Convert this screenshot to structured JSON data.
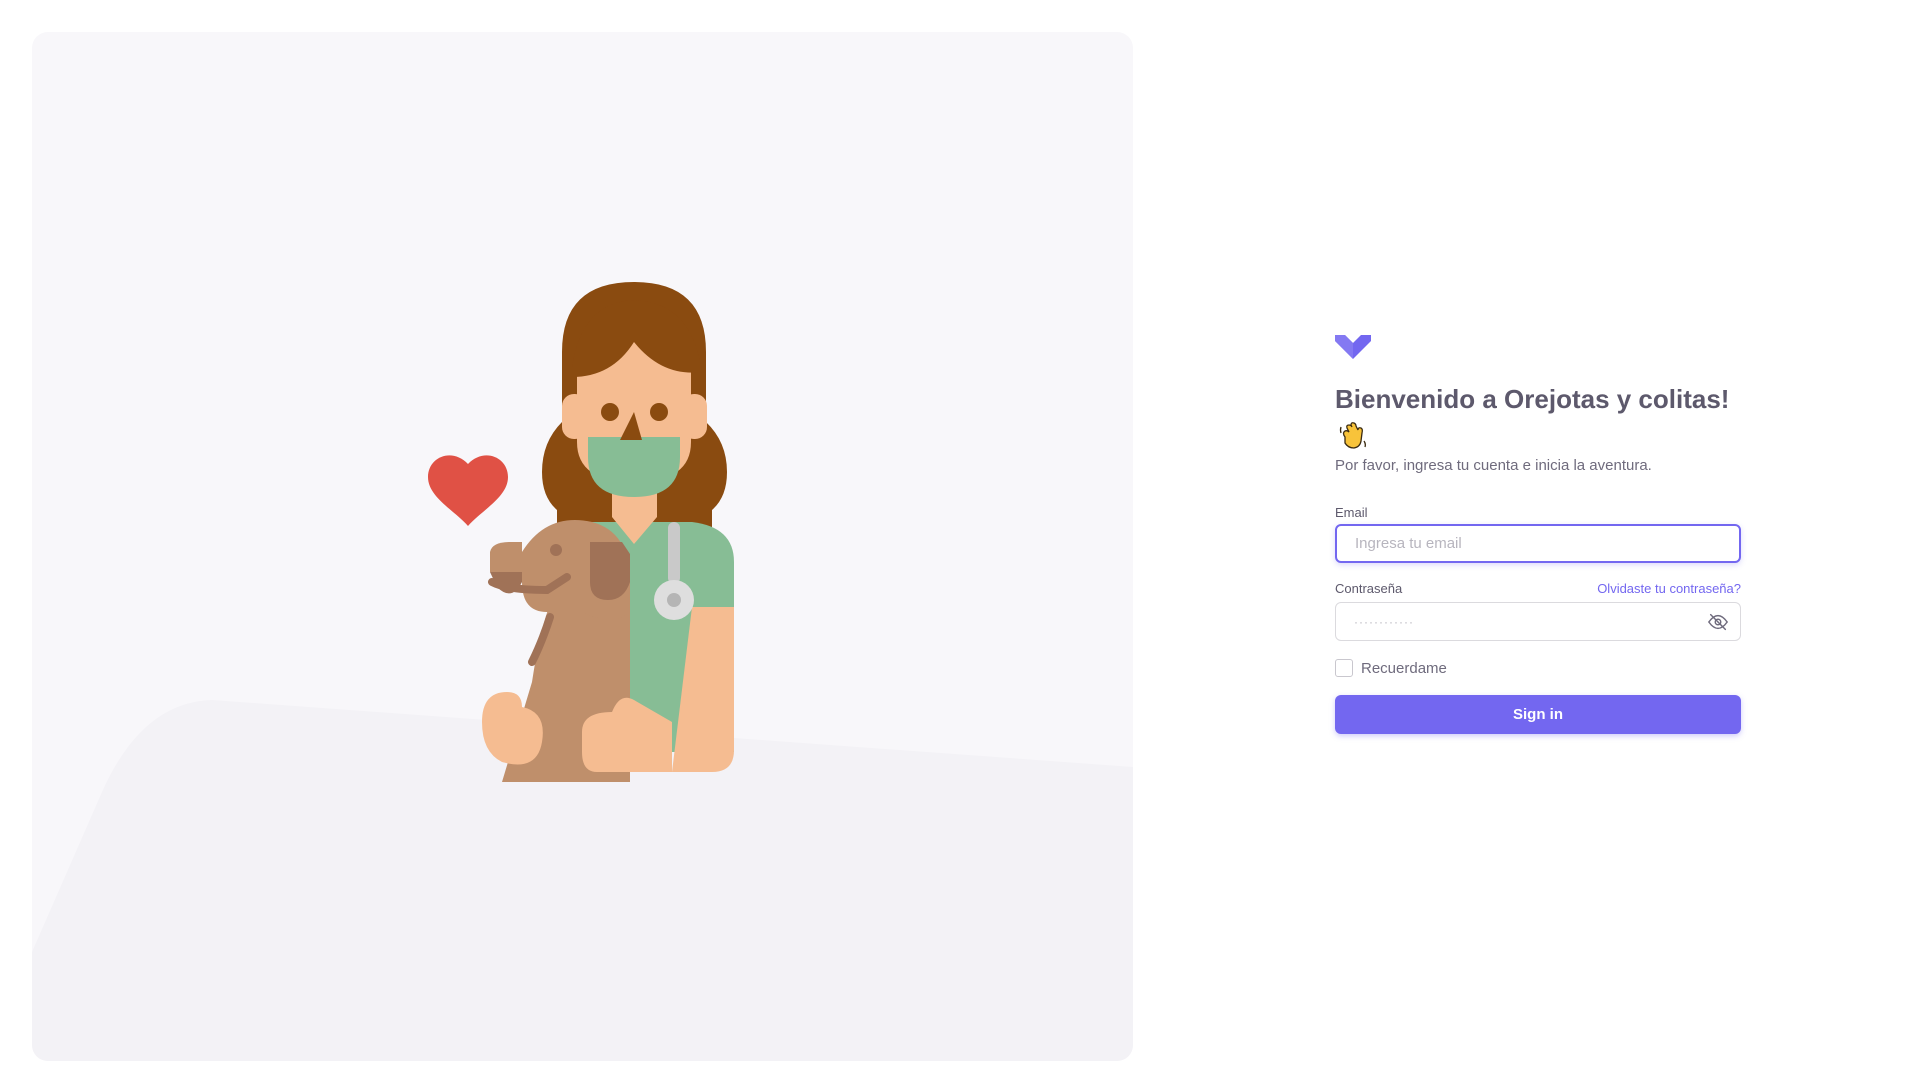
{
  "brand": {
    "logo_icon": "heart-chevron-icon",
    "accent_color": "#7367f0"
  },
  "welcome": {
    "title": "Bienvenido a Orejotas y colitas!",
    "wave_icon": "waving-hand-icon",
    "subtitle": "Por favor, ingresa tu cuenta e inicia la aventura."
  },
  "email": {
    "label": "Email",
    "placeholder": "Ingresa tu email",
    "value": ""
  },
  "password": {
    "label": "Contraseña",
    "forgot_link": "Olvidaste tu contraseña?",
    "placeholder": "············",
    "visibility_icon": "eye-off-icon"
  },
  "remember": {
    "label": "Recuerdame",
    "checked": false
  },
  "signin": {
    "label": "Sign in"
  },
  "illustration": {
    "icon": "veterinarian-with-dog-illustration",
    "heart_icon": "heart-icon"
  }
}
